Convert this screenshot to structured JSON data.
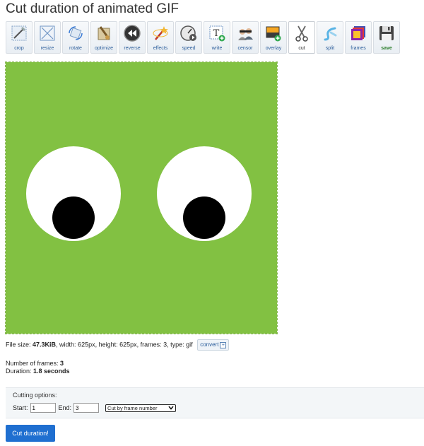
{
  "page": {
    "title": "Cut duration of animated GIF"
  },
  "toolbar": {
    "items": [
      {
        "label": "crop",
        "icon": "crop-icon"
      },
      {
        "label": "resize",
        "icon": "resize-icon"
      },
      {
        "label": "rotate",
        "icon": "rotate-icon"
      },
      {
        "label": "optimize",
        "icon": "optimize-icon"
      },
      {
        "label": "reverse",
        "icon": "reverse-icon"
      },
      {
        "label": "effects",
        "icon": "effects-icon"
      },
      {
        "label": "speed",
        "icon": "speed-icon"
      },
      {
        "label": "write",
        "icon": "write-icon"
      },
      {
        "label": "censor",
        "icon": "censor-icon"
      },
      {
        "label": "overlay",
        "icon": "overlay-icon"
      },
      {
        "label": "cut",
        "icon": "scissors-icon",
        "active": true
      },
      {
        "label": "split",
        "icon": "split-icon"
      },
      {
        "label": "frames",
        "icon": "frames-icon"
      },
      {
        "label": "save",
        "icon": "save-icon"
      }
    ]
  },
  "preview": {
    "background_color": "#82c142"
  },
  "file_info": {
    "size_label": "File size: ",
    "size_value": "47.3KiB",
    "details": ", width: 625px, height: 625px, frames: 3, type: gif",
    "convert_label": "convert"
  },
  "stats": {
    "frames_label": "Number of frames: ",
    "frames_value": "3",
    "duration_label": "Duration: ",
    "duration_value": "1.8 seconds"
  },
  "cutting_options": {
    "title": "Cutting options:",
    "start_label": "Start:",
    "start_value": "1",
    "end_label": "End:",
    "end_value": "3",
    "mode_selected": "Cut by frame number"
  },
  "submit": {
    "label": "Cut duration!"
  },
  "colors": {
    "accent": "#1f6fd0",
    "link": "#2b5d9b"
  }
}
